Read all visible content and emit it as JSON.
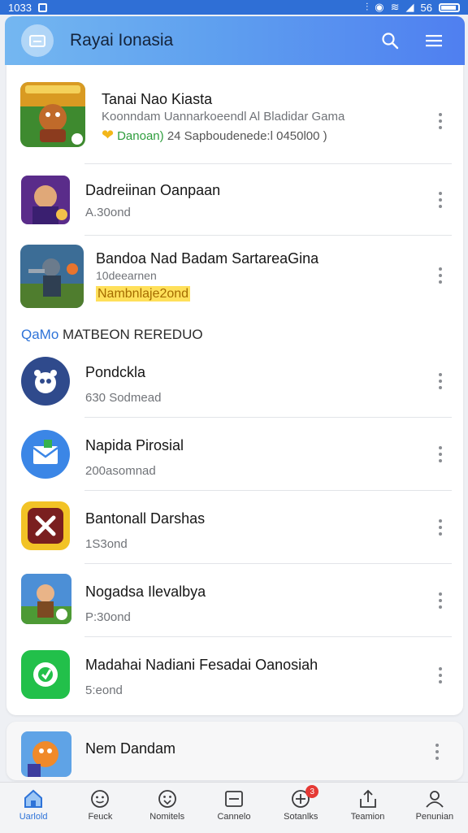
{
  "status_bar": {
    "time": "1033",
    "battery": "56"
  },
  "header": {
    "title": "Rayai Ionasia"
  },
  "list_top": [
    {
      "title": "Tanai Nao Kiasta",
      "description": "Koonndam Uannarkoeendl Al Bladidar Gama",
      "highlight": "Danoan)",
      "detail": "24 Sapboudenede:l 0450l00 )"
    },
    {
      "title": "Dadreiinan Oanpaan",
      "subtitle": "A.30ond"
    },
    {
      "title": "Bandoa Nad Badam SartareaGina",
      "subtitle": "10deearnen",
      "badge": "Nambnlaje2ond"
    }
  ],
  "section": {
    "accent": "QaMo",
    "title": "MATBEON REREDUO"
  },
  "list_section": [
    {
      "title": "Pondckla",
      "subtitle": "630 Sodmead"
    },
    {
      "title": "Napida Pirosial",
      "subtitle": "200asomnad"
    },
    {
      "title": "Bantonall Darshas",
      "subtitle": "1S3ond"
    },
    {
      "title": "Nogadsa Ilevalbya",
      "subtitle": "P:30ond"
    },
    {
      "title": "Madahai Nadiani Fesadai Oanosiah",
      "subtitle": "5:eond"
    }
  ],
  "peek_item": {
    "title": "Nem Dandam"
  },
  "bottom_nav": [
    {
      "label": "Uarlold",
      "icon": "home-icon",
      "active": true
    },
    {
      "label": "Feuck",
      "icon": "smile-icon"
    },
    {
      "label": "Nomitels",
      "icon": "emoji-icon"
    },
    {
      "label": "Cannelo",
      "icon": "inbox-icon"
    },
    {
      "label": "Sotanlks",
      "icon": "target-icon",
      "badge": "3"
    },
    {
      "label": "Teamion",
      "icon": "share-icon"
    },
    {
      "label": "Penunian",
      "icon": "person-icon"
    }
  ],
  "colors": {
    "accent": "#2e73d8",
    "header_gradient_start": "#74b7f1",
    "header_gradient_end": "#4f7ff0",
    "badge_red": "#e53935"
  }
}
